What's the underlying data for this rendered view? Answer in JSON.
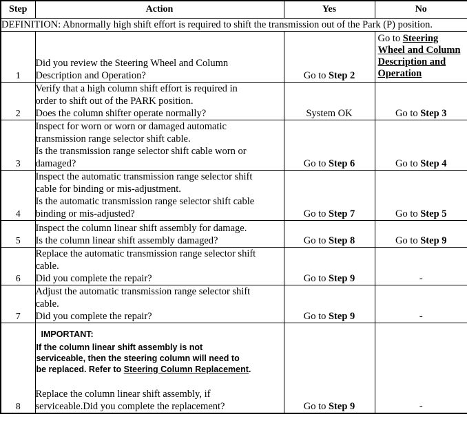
{
  "table": {
    "columns": [
      {
        "key": "step",
        "label": "Step"
      },
      {
        "key": "action",
        "label": "Action"
      },
      {
        "key": "yes",
        "label": "Yes"
      },
      {
        "key": "no",
        "label": "No"
      }
    ],
    "definition": "DEFINITION: Abnormally high shift effort is required to shift the transmission out of the Park (P) position.",
    "rows": [
      {
        "step": "1",
        "action_lines": [
          "Did you review the Steering Wheel and Column",
          "Description and Operation?"
        ],
        "yes_prefix": "Go to ",
        "yes_ref": "Step 2",
        "no_prefix": "Go to ",
        "no_link": "Steering Wheel and Column Description and Operation"
      },
      {
        "step": "2",
        "action_lines": [
          "Verify that a high column shift effort is required in",
          "order to shift out of the PARK position.",
          "Does the column shifter operate normally?"
        ],
        "yes_prefix": "",
        "yes_ref": "",
        "yes_plain": "System OK",
        "no_prefix": "Go to ",
        "no_ref": "Step 3"
      },
      {
        "step": "3",
        "action_lines": [
          "Inspect for worn or worn or damaged automatic",
          "transmission range selector shift cable.",
          "Is the transmission range selector shift cable worn or",
          "damaged?"
        ],
        "yes_prefix": "Go to ",
        "yes_ref": "Step 6",
        "no_prefix": "Go to ",
        "no_ref": "Step 4"
      },
      {
        "step": "4",
        "action_lines": [
          "Inspect the automatic transmission range selector shift",
          "cable for binding or mis-adjustment.",
          "Is the automatic transmission range selector shift cable",
          "binding or mis-adjusted?"
        ],
        "yes_prefix": "Go to ",
        "yes_ref": "Step 7",
        "no_prefix": "Go to ",
        "no_ref": "Step 5"
      },
      {
        "step": "5",
        "action_lines": [
          "Inspect the column linear shift assembly for damage.",
          "Is the column linear shift assembly damaged?"
        ],
        "yes_prefix": "Go to ",
        "yes_ref": "Step 8",
        "no_prefix": "Go to ",
        "no_ref": "Step 9"
      },
      {
        "step": "6",
        "action_lines": [
          "Replace the automatic transmission range selector shift",
          "cable.",
          "Did you complete the repair?"
        ],
        "yes_prefix": "Go to ",
        "yes_ref": "Step 9",
        "no_plain": "-"
      },
      {
        "step": "7",
        "action_lines": [
          "Adjust the automatic transmission range selector shift",
          "cable.",
          "Did you complete the repair?"
        ],
        "yes_prefix": "Go to ",
        "yes_ref": "Step 9",
        "no_plain": "-"
      },
      {
        "step": "8",
        "important_title": "IMPORTANT:",
        "important_lines": [
          "If the column linear shift assembly is not",
          "serviceable, then the steering column will need to",
          "be replaced. Refer to "
        ],
        "important_link": "Steering Column Replacement",
        "important_tail": ".",
        "action_lines": [
          "Replace the column linear shift assembly, if",
          "serviceable.Did you complete the replacement?"
        ],
        "yes_prefix": "Go to ",
        "yes_ref": "Step 9",
        "no_plain": "-"
      }
    ]
  }
}
